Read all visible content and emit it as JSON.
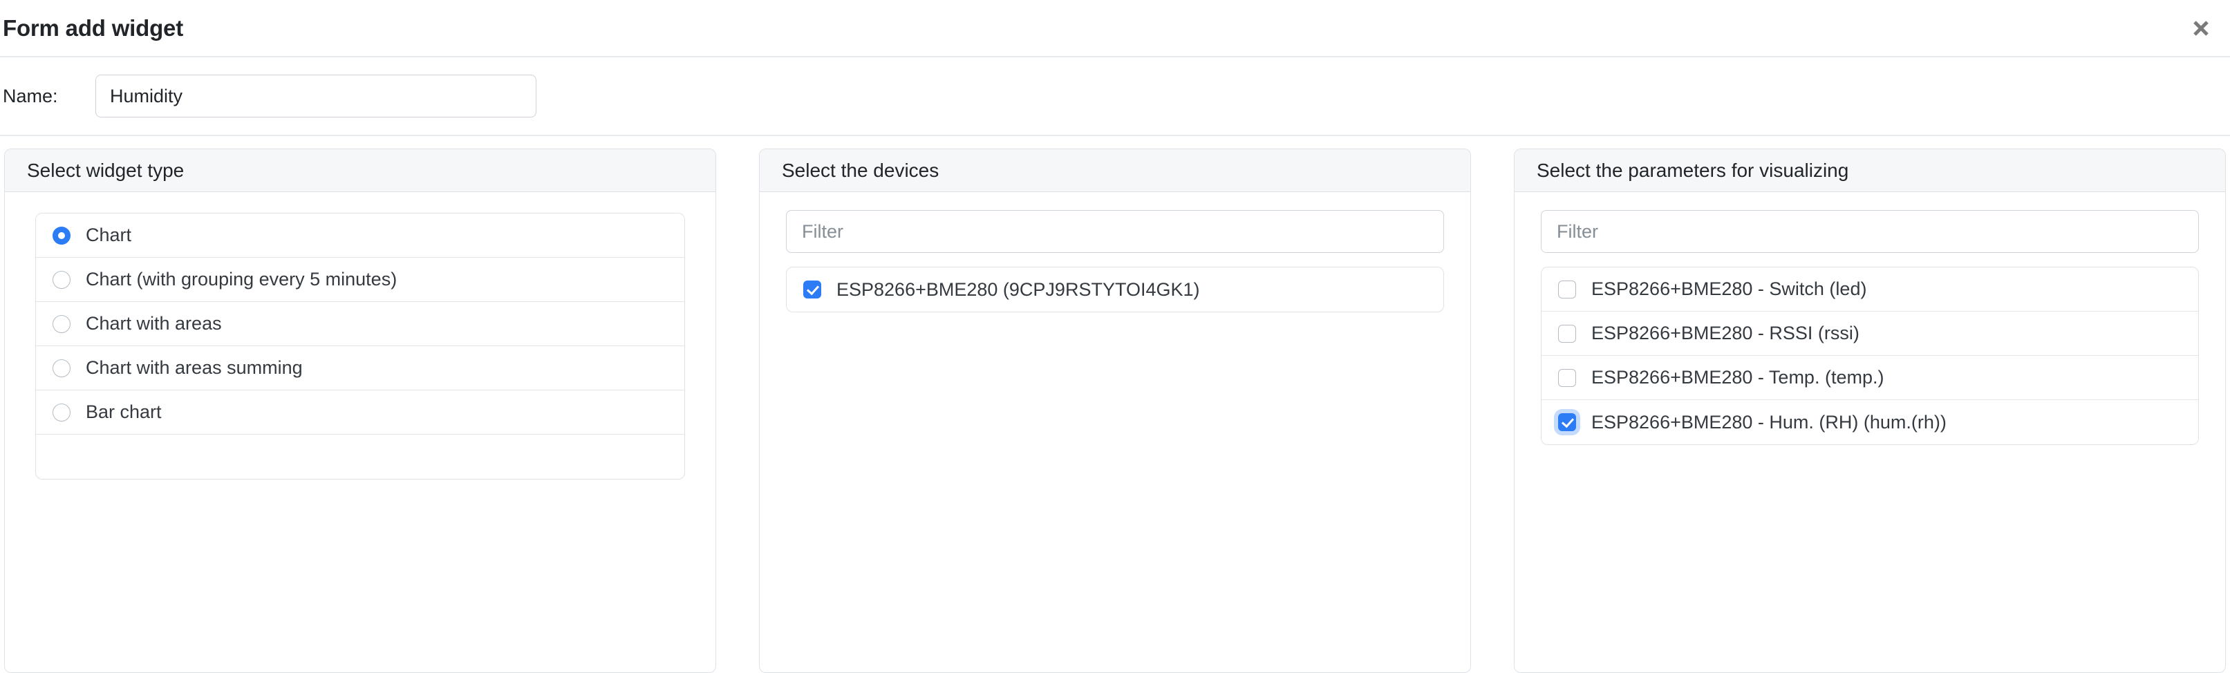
{
  "header": {
    "title": "Form add widget",
    "close_icon": "close-icon"
  },
  "name_field": {
    "label": "Name:",
    "value": "Humidity",
    "placeholder": ""
  },
  "panels": {
    "widget_type": {
      "title": "Select widget type",
      "options": [
        {
          "label": "Chart",
          "selected": true
        },
        {
          "label": "Chart (with grouping every 5 minutes)",
          "selected": false
        },
        {
          "label": "Chart with areas",
          "selected": false
        },
        {
          "label": "Chart with areas summing",
          "selected": false
        },
        {
          "label": "Bar chart",
          "selected": false
        },
        {
          "label": "",
          "selected": false
        }
      ]
    },
    "devices": {
      "title": "Select the devices",
      "filter_placeholder": "Filter",
      "filter_value": "",
      "items": [
        {
          "label": "ESP8266+BME280 (9CPJ9RSTYTOI4GK1)",
          "checked": true
        }
      ]
    },
    "parameters": {
      "title": "Select the parameters for visualizing",
      "filter_placeholder": "Filter",
      "filter_value": "",
      "items": [
        {
          "label": "ESP8266+BME280 - Switch (led)",
          "checked": false
        },
        {
          "label": "ESP8266+BME280 - RSSI (rssi)",
          "checked": false
        },
        {
          "label": "ESP8266+BME280 - Temp. (temp.)",
          "checked": false
        },
        {
          "label": "ESP8266+BME280 - Hum. (RH) (hum.(rh))",
          "checked": true
        }
      ]
    }
  },
  "colors": {
    "accent": "#2b7cf5",
    "panel_header_bg": "#f6f7f8",
    "border": "#dee2e6",
    "text": "#212529"
  }
}
